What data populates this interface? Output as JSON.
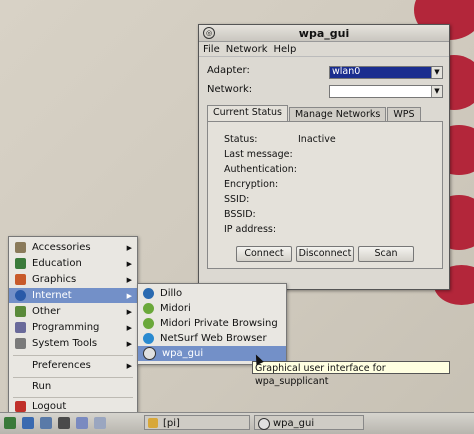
{
  "window": {
    "title": "wpa_gui",
    "menu": [
      "File",
      "Network",
      "Help"
    ],
    "adapter_label": "Adapter:",
    "adapter_value": "wlan0",
    "network_label": "Network:",
    "network_value": "",
    "tabs": [
      "Current Status",
      "Manage Networks",
      "WPS"
    ],
    "status_fields": [
      {
        "label": "Status:",
        "value": "Inactive"
      },
      {
        "label": "Last message:",
        "value": ""
      },
      {
        "label": "Authentication:",
        "value": ""
      },
      {
        "label": "Encryption:",
        "value": ""
      },
      {
        "label": "SSID:",
        "value": ""
      },
      {
        "label": "BSSID:",
        "value": ""
      },
      {
        "label": "IP address:",
        "value": ""
      }
    ],
    "buttons": {
      "connect": "Connect",
      "disconnect": "Disconnect",
      "scan": "Scan"
    }
  },
  "start_menu": {
    "items": [
      "Accessories",
      "Education",
      "Graphics",
      "Internet",
      "Other",
      "Programming",
      "System Tools",
      "Preferences",
      "Run",
      "Logout"
    ],
    "highlighted": "Internet"
  },
  "internet_submenu": {
    "items": [
      "Dillo",
      "Midori",
      "Midori Private Browsing",
      "NetSurf Web Browser",
      "wpa_gui"
    ],
    "highlighted": "wpa_gui"
  },
  "tooltip": "Graphical user interface for wpa_supplicant",
  "taskbar": {
    "tasks": [
      "[pi]",
      "wpa_gui"
    ]
  },
  "colors": {
    "highlight": "#7390c8",
    "adapter_bg": "#1a2d8f",
    "raspberry": "#b3263a"
  }
}
